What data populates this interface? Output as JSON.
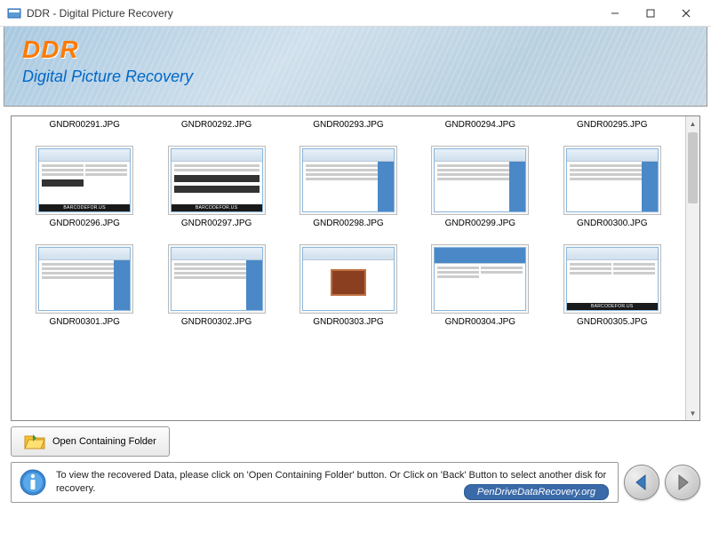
{
  "window": {
    "title": "DDR - Digital Picture Recovery"
  },
  "header": {
    "logo": "DDR",
    "subtitle": "Digital Picture Recovery"
  },
  "files": {
    "row1": [
      {
        "name": "GNDR00291.JPG"
      },
      {
        "name": "GNDR00292.JPG"
      },
      {
        "name": "GNDR00293.JPG"
      },
      {
        "name": "GNDR00294.JPG"
      },
      {
        "name": "GNDR00295.JPG"
      }
    ],
    "row2": [
      {
        "name": "GNDR00296.JPG"
      },
      {
        "name": "GNDR00297.JPG"
      },
      {
        "name": "GNDR00298.JPG"
      },
      {
        "name": "GNDR00299.JPG"
      },
      {
        "name": "GNDR00300.JPG"
      }
    ],
    "row3": [
      {
        "name": "GNDR00301.JPG"
      },
      {
        "name": "GNDR00302.JPG"
      },
      {
        "name": "GNDR00303.JPG"
      },
      {
        "name": "GNDR00304.JPG"
      },
      {
        "name": "GNDR00305.JPG"
      }
    ]
  },
  "thumb_footer": "BARCODEFOR.US",
  "buttons": {
    "open_folder": "Open Containing Folder"
  },
  "footer": {
    "info": "To view the recovered Data, please click on 'Open Containing Folder' button. Or Click on 'Back' Button to select another disk for recovery.",
    "watermark": "PenDriveDataRecovery.org"
  }
}
